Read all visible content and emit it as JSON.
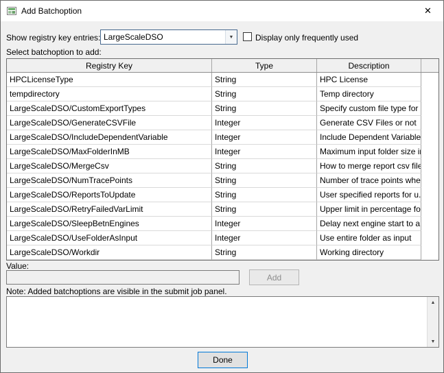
{
  "window": {
    "title": "Add Batchoption",
    "close_glyph": "✕"
  },
  "controls": {
    "registry_label": "Show registry key entries:",
    "registry_value": "LargeScaleDSO",
    "dropdown_glyph": "▼",
    "frequent_label": "Display only frequently used",
    "frequent_checked": "false",
    "select_label": "Select batchoption to add:",
    "value_label": "Value:",
    "value_text": "",
    "add_label": "Add",
    "note": "Note: Added batchoptions are visible in the submit job panel.",
    "done_label": "Done",
    "scroll_up_glyph": "▲",
    "scroll_down_glyph": "▼"
  },
  "table": {
    "headers": [
      "Registry Key",
      "Type",
      "Description"
    ],
    "rows": [
      {
        "key": "HPCLicenseType",
        "type": "String",
        "desc": "HPC License"
      },
      {
        "key": "tempdirectory",
        "type": "String",
        "desc": "Temp directory"
      },
      {
        "key": "LargeScaleDSO/CustomExportTypes",
        "type": "String",
        "desc": "Specify custom file type for ..."
      },
      {
        "key": "LargeScaleDSO/GenerateCSVFile",
        "type": "Integer",
        "desc": "Generate CSV Files or not"
      },
      {
        "key": "LargeScaleDSO/IncludeDependentVariable",
        "type": "Integer",
        "desc": "Include Dependent Variable ..."
      },
      {
        "key": "LargeScaleDSO/MaxFolderInMB",
        "type": "Integer",
        "desc": "Maximum input folder size in..."
      },
      {
        "key": "LargeScaleDSO/MergeCsv",
        "type": "String",
        "desc": "How to merge report csv files"
      },
      {
        "key": "LargeScaleDSO/NumTracePoints",
        "type": "String",
        "desc": "Number of trace points whe..."
      },
      {
        "key": "LargeScaleDSO/ReportsToUpdate",
        "type": "String",
        "desc": "User specified reports for u..."
      },
      {
        "key": "LargeScaleDSO/RetryFailedVarLimit",
        "type": "String",
        "desc": "Upper limit in percentage fo..."
      },
      {
        "key": "LargeScaleDSO/SleepBetnEngines",
        "type": "Integer",
        "desc": "Delay next engine start to a..."
      },
      {
        "key": "LargeScaleDSO/UseFolderAsInput",
        "type": "Integer",
        "desc": "Use entire folder as input"
      },
      {
        "key": "LargeScaleDSO/Workdir",
        "type": "String",
        "desc": "Working directory"
      }
    ]
  },
  "colors": {
    "accent": "#0078d7",
    "disabled_text": "#8d8d8d",
    "header_bg": "#f0f0f0"
  }
}
